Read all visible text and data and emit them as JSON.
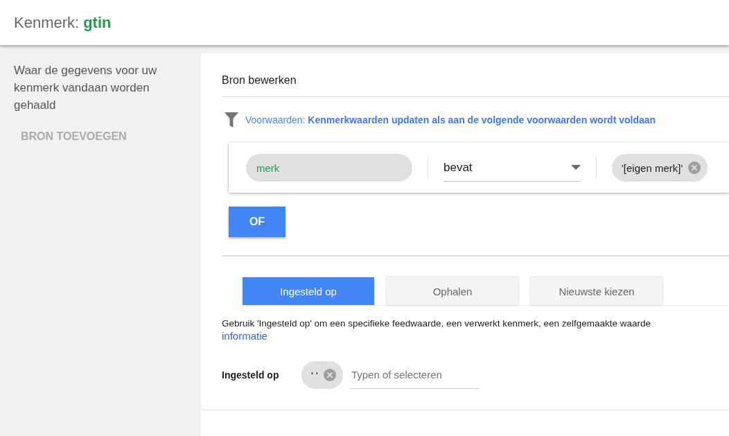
{
  "header": {
    "label": "Kenmerk:",
    "value": "gtin"
  },
  "sidebar": {
    "description": "Waar de gegevens voor uw kenmerk vandaan worden gehaald",
    "add_button": "BRON TOEVOEGEN"
  },
  "editor": {
    "title": "Bron bewerken",
    "conditions": {
      "label": "Voorwaarden:",
      "text": "Kenmerkwaarden updaten als aan de volgende voorwaarden wordt voldaan"
    },
    "rule": {
      "attribute": "merk",
      "operator": "bevat",
      "value_chip": "'[eigen merk]'"
    },
    "or_button": "OF",
    "tabs": [
      {
        "label": "Ingesteld op",
        "selected": true
      },
      {
        "label": "Ophalen",
        "selected": false
      },
      {
        "label": "Nieuwste kiezen",
        "selected": false
      }
    ],
    "help_text": "Gebruik 'Ingesteld op' om een specifieke feedwaarde, een verwerkt kenmerk, een zelfgemaakte waarde",
    "help_link": "informatie",
    "set_to": {
      "label": "Ingesteld op",
      "chip": "' '",
      "placeholder": "Typen of selecteren"
    }
  }
}
